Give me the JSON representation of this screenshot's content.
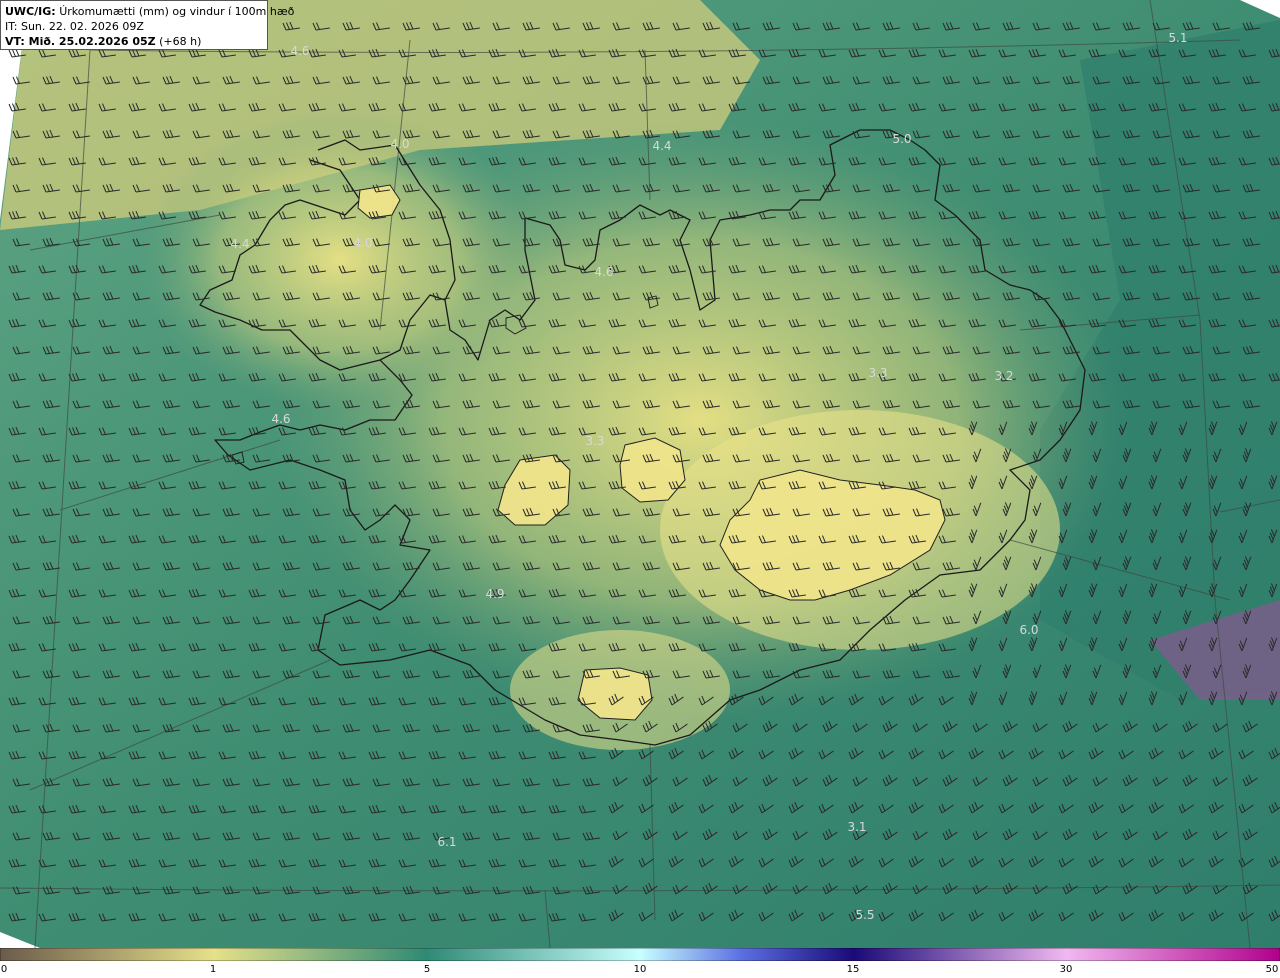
{
  "header": {
    "model": "UWC/IG:",
    "title": "Úrkomumætti (mm) og vindur í 100m hæð",
    "initial_time": "IT: Sun. 22. 02. 2026 09Z",
    "valid_prefix": "VT: Mið. 25.02.2026 05Z",
    "valid_suffix": "(+68 h)"
  },
  "value_labels": [
    "5.1",
    "4.4",
    "5.0",
    "4.0",
    "4.4",
    "4.0",
    "4.6",
    "3.3",
    "3.2",
    "4.6",
    "3.3",
    "4.9",
    "6.0",
    "6.1",
    "3.1",
    "5.5",
    "4.6"
  ],
  "colorbar": {
    "ticks": [
      "0",
      "1",
      "5",
      "10",
      "15",
      "30",
      "50"
    ],
    "colors": [
      "#6b5b4b",
      "#e6e08a",
      "#2f8a74",
      "#c8ffff",
      "#1a0a78",
      "#f0b8f0",
      "#b0008c"
    ]
  },
  "map": {
    "land_color": "#e3dd86",
    "sea_color": "#3a8a72",
    "barb_color": "#2a2a2a",
    "coast_color": "#1a1a1a"
  }
}
